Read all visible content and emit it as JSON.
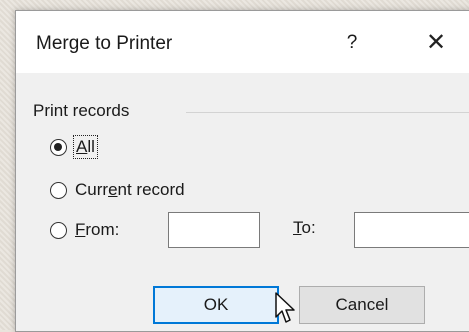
{
  "dialog": {
    "title": "Merge to Printer",
    "help_label": "?",
    "close_label": "✕"
  },
  "print_records": {
    "group_label": "Print records",
    "options": [
      {
        "prefix": "",
        "mnemonic": "A",
        "suffix": "ll",
        "selected": true
      },
      {
        "prefix": "Curr",
        "mnemonic": "e",
        "suffix": "nt record",
        "selected": false
      },
      {
        "prefix": "",
        "mnemonic": "F",
        "suffix": "rom:",
        "selected": false
      }
    ],
    "from_value": "",
    "to_label_mnemonic": "T",
    "to_label_suffix": "o:",
    "to_value": ""
  },
  "buttons": {
    "ok_label": "OK",
    "cancel_label": "Cancel"
  }
}
